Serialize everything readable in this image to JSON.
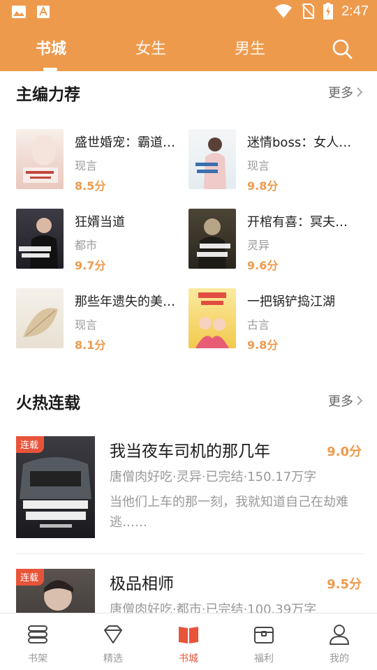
{
  "status_bar": {
    "time": "2:47",
    "left_icons": [
      "image-icon",
      "font-app-icon"
    ],
    "right_icons": [
      "wifi-icon",
      "no-sim-icon",
      "battery-charging-icon"
    ]
  },
  "top_tabs": [
    {
      "label": "书城",
      "active": true
    },
    {
      "label": "女生",
      "active": false
    },
    {
      "label": "男生",
      "active": false
    }
  ],
  "search": {
    "icon": "search-icon"
  },
  "editor_picks": {
    "title": "主编力荐",
    "more": "更多",
    "books": [
      {
        "title": "盛世婚宠：霸道…",
        "genre": "现言",
        "score": "8.5分",
        "cover_color": "#f3e7e1"
      },
      {
        "title": "迷情boss：女人…",
        "genre": "现言",
        "score": "9.8分",
        "cover_color": "#eef3f5"
      },
      {
        "title": "狂婿当道",
        "genre": "都市",
        "score": "9.7分",
        "cover_color": "#2d2d33"
      },
      {
        "title": "开棺有喜：冥夫…",
        "genre": "灵异",
        "score": "9.6分",
        "cover_color": "#3f3a2e"
      },
      {
        "title": "那些年遗失的美…",
        "genre": "现言",
        "score": "8.1分",
        "cover_color": "#efe9df"
      },
      {
        "title": "一把锅铲捣江湖",
        "genre": "古言",
        "score": "9.8分",
        "cover_color": "#f5dc6a"
      }
    ]
  },
  "hot_serials": {
    "title": "火热连载",
    "more": "更多",
    "books": [
      {
        "badge": "连载",
        "title": "我当夜车司机的那几年",
        "score": "9.0分",
        "meta": "唐僧肉好吃·灵异·已完结·150.17万字",
        "desc": "当他们上车的那一刻，我就知道自己在劫难逃……",
        "cover_color": "#2a2a2e"
      },
      {
        "badge": "连载",
        "title": "极品相师",
        "score": "9.5分",
        "meta": "唐僧肉好吃·都市·已完结·100.39万字",
        "desc": "",
        "cover_color": "#3b3838"
      }
    ]
  },
  "bottom_nav": [
    {
      "label": "书架",
      "icon": "bookshelf-icon",
      "active": false
    },
    {
      "label": "精选",
      "icon": "gem-icon",
      "active": false
    },
    {
      "label": "书城",
      "icon": "book-open-icon",
      "active": true
    },
    {
      "label": "福利",
      "icon": "gift-box-icon",
      "active": false
    },
    {
      "label": "我的",
      "icon": "user-icon",
      "active": false
    }
  ],
  "colors": {
    "brand": "#EE9A4D",
    "accent_red": "#E8543A",
    "score": "#EE9A4D",
    "muted_text": "#999999"
  }
}
